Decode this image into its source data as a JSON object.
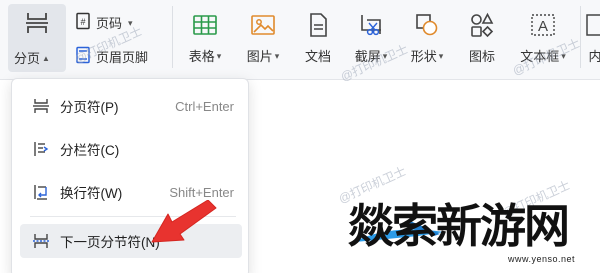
{
  "ribbon": {
    "page_break_button": "分页",
    "page_number_button": "页码",
    "header_footer_button": "页眉页脚",
    "tools": [
      {
        "label": "表格",
        "icon": "table-icon",
        "dropdown": true
      },
      {
        "label": "图片",
        "icon": "picture-icon",
        "dropdown": true
      },
      {
        "label": "文档",
        "icon": "document-icon",
        "dropdown": false
      },
      {
        "label": "截屏",
        "icon": "screenshot-icon",
        "dropdown": true
      },
      {
        "label": "形状",
        "icon": "shapes-icon",
        "dropdown": true
      },
      {
        "label": "图标",
        "icon": "icons-icon",
        "dropdown": false
      },
      {
        "label": "文本框",
        "icon": "textbox-icon",
        "dropdown": true
      },
      {
        "label": "内",
        "icon": "more-icon",
        "dropdown": false
      }
    ]
  },
  "menu": {
    "items": [
      {
        "label": "分页符(P)",
        "shortcut": "Ctrl+Enter",
        "icon": "page-break-icon"
      },
      {
        "label": "分栏符(C)",
        "shortcut": "",
        "icon": "column-break-icon"
      },
      {
        "label": "换行符(W)",
        "shortcut": "Shift+Enter",
        "icon": "line-break-icon"
      },
      {
        "label": "下一页分节符(N)",
        "shortcut": "",
        "icon": "next-page-section-break-icon"
      }
    ]
  },
  "watermark": "@打印机卫士",
  "logo": {
    "title": "燚索新游网",
    "url": "www.yenso.net"
  },
  "colors": {
    "arrow": "#e8332f",
    "icon_blue": "#2b63d9",
    "icon_green": "#2a9a4a",
    "icon_orange": "#e08a2c",
    "highlight": "#eceef1"
  }
}
